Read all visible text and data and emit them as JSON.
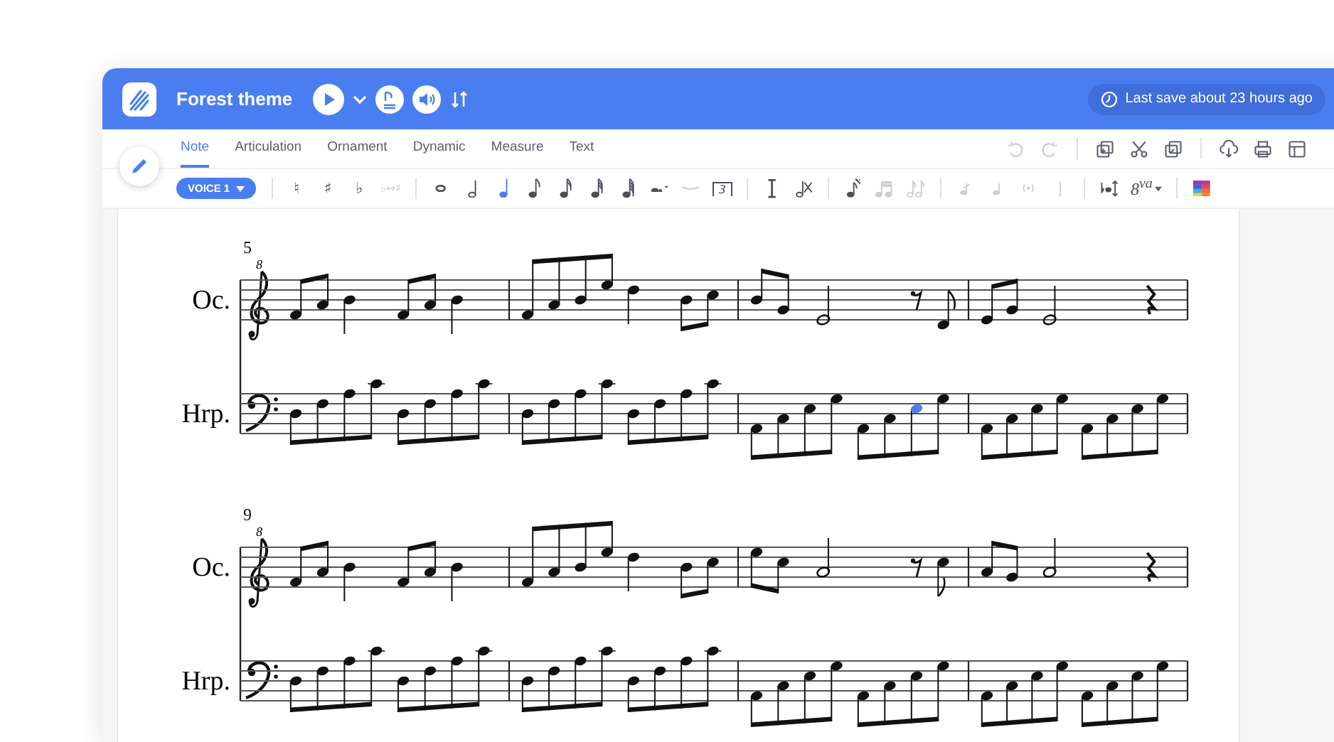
{
  "header": {
    "title": "Forest theme",
    "save_status": "Last save about 23 hours ago"
  },
  "tabs": [
    {
      "label": "Note",
      "selected": true
    },
    {
      "label": "Articulation",
      "selected": false
    },
    {
      "label": "Ornament",
      "selected": false
    },
    {
      "label": "Dynamic",
      "selected": false
    },
    {
      "label": "Measure",
      "selected": false
    },
    {
      "label": "Text",
      "selected": false
    }
  ],
  "edit_groups": [
    [
      {
        "kind": "undo",
        "disabled": true
      },
      {
        "kind": "redo",
        "disabled": true
      }
    ],
    [
      {
        "kind": "duplicate",
        "disabled": false
      },
      {
        "kind": "cut",
        "disabled": false
      },
      {
        "kind": "paste",
        "disabled": false
      }
    ],
    [
      {
        "kind": "download",
        "disabled": false
      },
      {
        "kind": "print",
        "disabled": false
      },
      {
        "kind": "layout",
        "disabled": false
      }
    ]
  ],
  "voice": {
    "label": "VOICE 1"
  },
  "tool_groups": [
    [
      {
        "kind": "natural",
        "label": "♮",
        "disabled": false
      },
      {
        "kind": "sharp",
        "label": "♯",
        "disabled": false
      },
      {
        "kind": "flat",
        "label": "♭",
        "disabled": false
      },
      {
        "kind": "enharmonic",
        "label": "♭↔♯",
        "disabled": true
      }
    ],
    [
      {
        "kind": "whole",
        "disabled": false,
        "selected": false
      },
      {
        "kind": "half",
        "disabled": false,
        "selected": false
      },
      {
        "kind": "quarter",
        "disabled": false,
        "selected": true
      },
      {
        "kind": "eighth",
        "disabled": false,
        "selected": false
      },
      {
        "kind": "sixteenth",
        "disabled": false,
        "selected": false
      },
      {
        "kind": "thirty_second",
        "disabled": false,
        "selected": false
      },
      {
        "kind": "sixty_fourth",
        "disabled": false,
        "selected": false
      },
      {
        "kind": "dot",
        "disabled": false
      },
      {
        "kind": "tie",
        "disabled": true
      },
      {
        "kind": "triplet",
        "label": "3",
        "disabled": false
      }
    ],
    [
      {
        "kind": "cursor",
        "disabled": false
      },
      {
        "kind": "delete_note",
        "disabled": false
      }
    ],
    [
      {
        "kind": "grace",
        "disabled": false
      },
      {
        "kind": "beam",
        "disabled": true
      },
      {
        "kind": "unbeam",
        "disabled": true
      }
    ],
    [
      {
        "kind": "slashed_note",
        "disabled": true
      },
      {
        "kind": "small_note",
        "disabled": true
      },
      {
        "kind": "parenthesis",
        "disabled": true
      },
      {
        "kind": "stem",
        "disabled": true
      }
    ],
    [
      {
        "kind": "transpose",
        "disabled": false
      },
      {
        "kind": "ottava",
        "label": "8$^{va}$",
        "disabled": false
      }
    ],
    [
      {
        "kind": "color",
        "disabled": false
      }
    ]
  ],
  "systems": [
    {
      "measure_number": "5",
      "staves": [
        {
          "name": "Oc.",
          "kind": "treble",
          "clef_mark": "8"
        },
        {
          "name": "Hrp.",
          "kind": "bass"
        }
      ]
    },
    {
      "measure_number": "9",
      "staves": [
        {
          "name": "Oc.",
          "kind": "treble",
          "clef_mark": "8"
        },
        {
          "name": "Hrp.",
          "kind": "bass"
        }
      ]
    }
  ]
}
